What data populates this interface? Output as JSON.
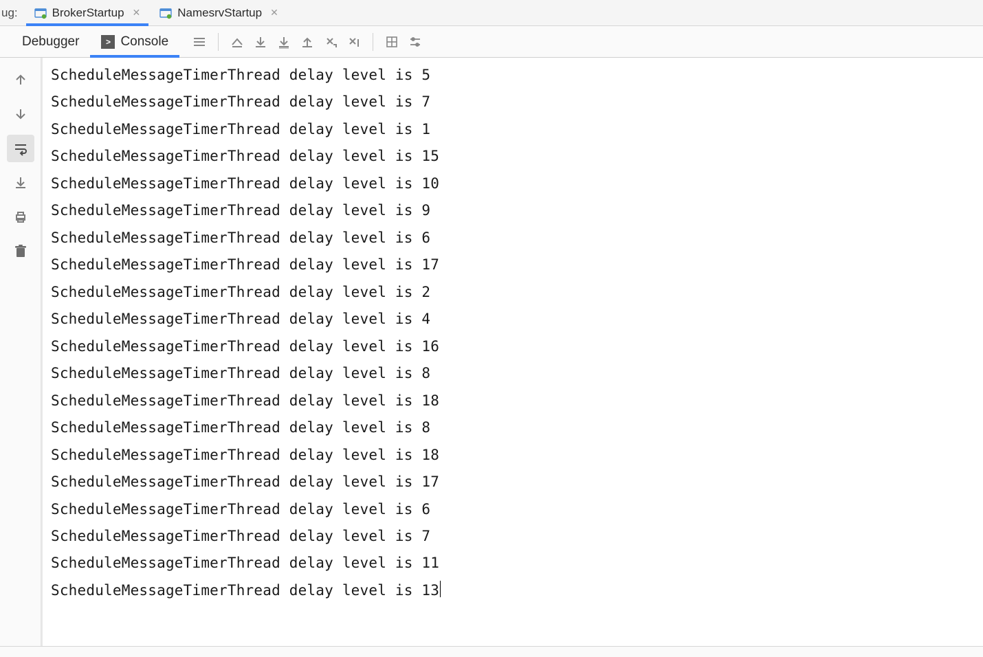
{
  "runTabsLabel": "ug:",
  "runTabs": [
    {
      "label": "BrokerStartup",
      "active": true
    },
    {
      "label": "NamesrvStartup",
      "active": false
    }
  ],
  "debugTabs": {
    "debugger": "Debugger",
    "console": "Console"
  },
  "consoleLines": [
    "ScheduleMessageTimerThread delay level is 5",
    "ScheduleMessageTimerThread delay level is 7",
    "ScheduleMessageTimerThread delay level is 1",
    "ScheduleMessageTimerThread delay level is 15",
    "ScheduleMessageTimerThread delay level is 10",
    "ScheduleMessageTimerThread delay level is 9",
    "ScheduleMessageTimerThread delay level is 6",
    "ScheduleMessageTimerThread delay level is 17",
    "ScheduleMessageTimerThread delay level is 2",
    "ScheduleMessageTimerThread delay level is 4",
    "ScheduleMessageTimerThread delay level is 16",
    "ScheduleMessageTimerThread delay level is 8",
    "ScheduleMessageTimerThread delay level is 18",
    "ScheduleMessageTimerThread delay level is 8",
    "ScheduleMessageTimerThread delay level is 18",
    "ScheduleMessageTimerThread delay level is 17",
    "ScheduleMessageTimerThread delay level is 6",
    "ScheduleMessageTimerThread delay level is 7",
    "ScheduleMessageTimerThread delay level is 11",
    "ScheduleMessageTimerThread delay level is 13"
  ]
}
